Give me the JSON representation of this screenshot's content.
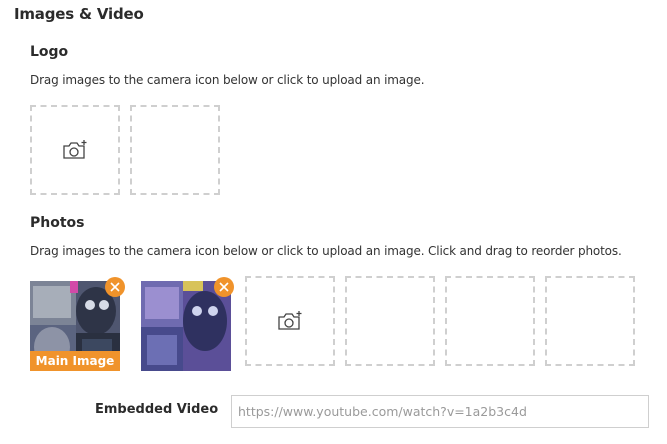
{
  "section_title": "Images & Video",
  "logo": {
    "title": "Logo",
    "help": "Drag images to the camera icon below or click to upload an image."
  },
  "photos": {
    "title": "Photos",
    "help": "Drag images to the camera icon below or click to upload an image. Click and drag to reorder photos.",
    "main_badge": "Main Image"
  },
  "video": {
    "label": "Embedded Video",
    "placeholder": "https://www.youtube.com/watch?v=1a2b3c4d",
    "value": ""
  },
  "colors": {
    "accent": "#f0932b",
    "slot_border": "#cfcfcf"
  },
  "icons": {
    "upload": "camera-plus-icon",
    "remove": "close-icon"
  }
}
